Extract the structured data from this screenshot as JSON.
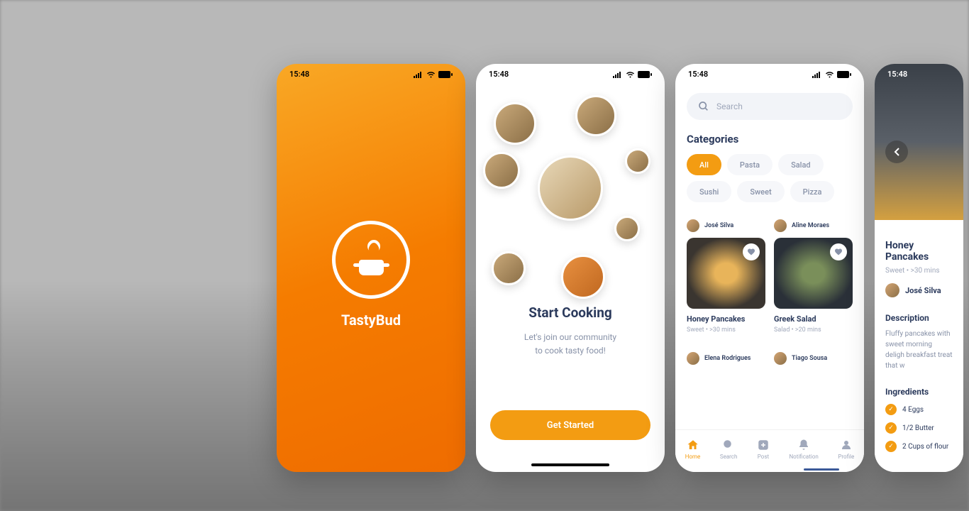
{
  "status_time": "15:48",
  "app_name": "TastyBud",
  "onboard": {
    "title": "Start Cooking",
    "subtitle1": "Let's join our community",
    "subtitle2": "to cook tasty food!",
    "cta": "Get Started"
  },
  "home": {
    "search_placeholder": "Search",
    "categories_title": "Categories",
    "chips": [
      "All",
      "Pasta",
      "Salad",
      "Sushi",
      "Sweet",
      "Pizza"
    ],
    "recipes": [
      {
        "author": "José Silva",
        "name": "Honey Pancakes",
        "meta": "Sweet  •  >30 mins"
      },
      {
        "author": "Aline Moraes",
        "name": "Greek Salad",
        "meta": "Salad  •  >20 mins"
      },
      {
        "author": "Elena Rodrigues",
        "name": "",
        "meta": ""
      },
      {
        "author": "Tiago Sousa",
        "name": "",
        "meta": ""
      }
    ],
    "nav": [
      "Home",
      "Search",
      "Post",
      "Notification",
      "Profile"
    ]
  },
  "detail": {
    "title": "Honey Pancakes",
    "meta": "Sweet • >30 mins",
    "author": "José Silva",
    "desc_title": "Description",
    "desc": "Fluffy pancakes with sweet morning deligh breakfast treat that w",
    "ing_title": "Ingredients",
    "ingredients": [
      "4 Eggs",
      "1/2 Butter",
      "2 Cups of flour"
    ]
  }
}
